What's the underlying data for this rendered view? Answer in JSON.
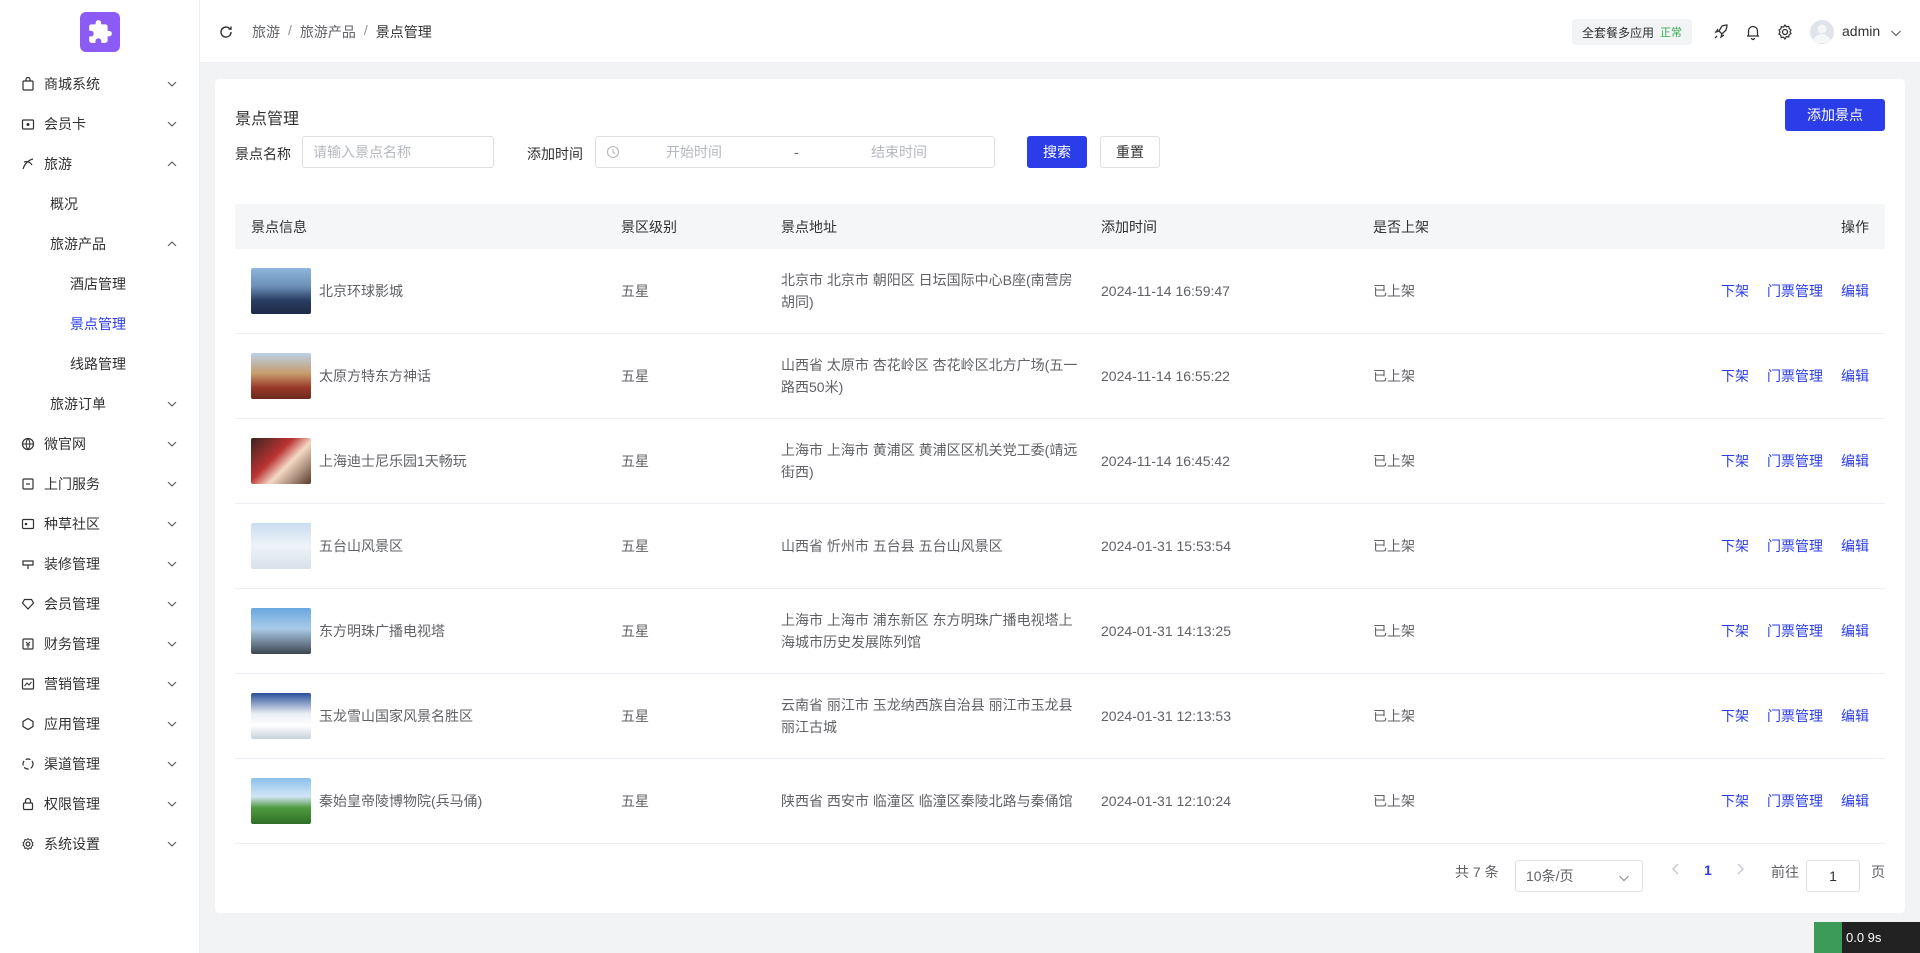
{
  "sidebar": {
    "items": [
      {
        "label": "商城系统",
        "icon": "bag-icon"
      },
      {
        "label": "会员卡",
        "icon": "card-icon"
      },
      {
        "label": "旅游",
        "icon": "travel-icon"
      },
      {
        "label": "概况"
      },
      {
        "label": "旅游产品"
      },
      {
        "label": "酒店管理"
      },
      {
        "label": "景点管理"
      },
      {
        "label": "线路管理"
      },
      {
        "label": "旅游订单"
      },
      {
        "label": "微官网",
        "icon": "globe-icon"
      },
      {
        "label": "上门服务",
        "icon": "service-icon"
      },
      {
        "label": "种草社区",
        "icon": "community-icon"
      },
      {
        "label": "装修管理",
        "icon": "decorate-icon"
      },
      {
        "label": "会员管理",
        "icon": "member-icon"
      },
      {
        "label": "财务管理",
        "icon": "finance-icon"
      },
      {
        "label": "营销管理",
        "icon": "marketing-icon"
      },
      {
        "label": "应用管理",
        "icon": "app-icon"
      },
      {
        "label": "渠道管理",
        "icon": "channel-icon"
      },
      {
        "label": "权限管理",
        "icon": "lock-icon"
      },
      {
        "label": "系统设置",
        "icon": "settings-icon"
      }
    ]
  },
  "header": {
    "breadcrumb": [
      "旅游",
      "旅游产品",
      "景点管理"
    ],
    "plan_label": "全套餐多应用",
    "plan_status": "正常",
    "user": "admin"
  },
  "page": {
    "title": "景点管理",
    "add_button": "添加景点",
    "filter": {
      "name_label": "景点名称",
      "name_placeholder": "请输入景点名称",
      "time_label": "添加时间",
      "start_placeholder": "开始时间",
      "separator": "-",
      "end_placeholder": "结束时间",
      "search_button": "搜索",
      "reset_button": "重置"
    }
  },
  "table": {
    "columns": [
      "景点信息",
      "景区级别",
      "景点地址",
      "添加时间",
      "是否上架",
      "操作"
    ],
    "actions": [
      "下架",
      "门票管理",
      "编辑"
    ],
    "rows": [
      {
        "name": "北京环球影城",
        "level": "五星",
        "address": "北京市 北京市 朝阳区 日坛国际中心B座(南营房胡同)",
        "time": "2024-11-14 16:59:47",
        "status": "已上架"
      },
      {
        "name": "太原方特东方神话",
        "level": "五星",
        "address": "山西省 太原市 杏花岭区 杏花岭区北方广场(五一路西50米)",
        "time": "2024-11-14 16:55:22",
        "status": "已上架"
      },
      {
        "name": "上海迪士尼乐园1天畅玩",
        "level": "五星",
        "address": "上海市 上海市 黄浦区 黄浦区区机关党工委(靖远街西)",
        "time": "2024-11-14 16:45:42",
        "status": "已上架"
      },
      {
        "name": "五台山风景区",
        "level": "五星",
        "address": "山西省 忻州市 五台县 五台山风景区",
        "time": "2024-01-31 15:53:54",
        "status": "已上架"
      },
      {
        "name": "东方明珠广播电视塔",
        "level": "五星",
        "address": "上海市 上海市 浦东新区 东方明珠广播电视塔上海城市历史发展陈列馆",
        "time": "2024-01-31 14:13:25",
        "status": "已上架"
      },
      {
        "name": "玉龙雪山国家风景名胜区",
        "level": "五星",
        "address": "云南省 丽江市 玉龙纳西族自治县 丽江市玉龙县丽江古城",
        "time": "2024-01-31 12:13:53",
        "status": "已上架"
      },
      {
        "name": "秦始皇帝陵博物院(兵马俑)",
        "level": "五星",
        "address": "陕西省 西安市 临潼区 临潼区秦陵北路与秦俑馆",
        "time": "2024-01-31 12:10:24",
        "status": "已上架"
      }
    ]
  },
  "pagination": {
    "total_text": "共 7 条",
    "page_size": "10条/页",
    "current_page": "1",
    "goto_label": "前往",
    "goto_value": "1",
    "page_suffix": "页"
  },
  "widget": {
    "text": "0.0 9s"
  },
  "colors": {
    "primary": "#2b3de8",
    "logo": "#8c5bf5",
    "ok": "#36b04d"
  }
}
